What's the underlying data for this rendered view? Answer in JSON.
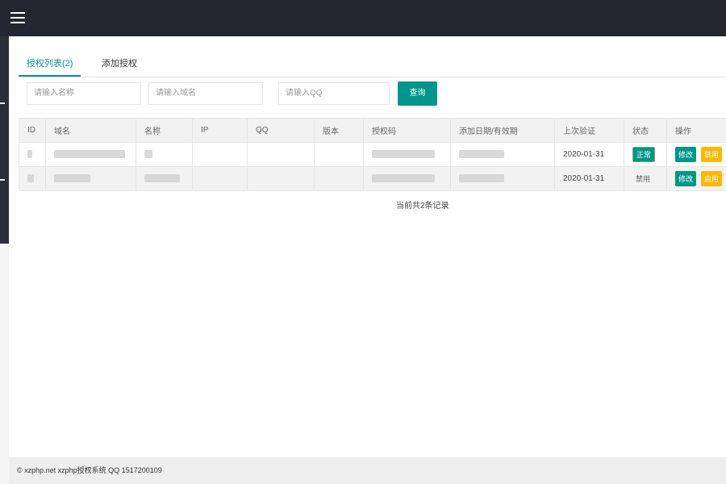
{
  "topbar": {
    "menu_icon": "hamburger-menu-icon"
  },
  "tabs": [
    {
      "label": "授权列表(2)",
      "active": true
    },
    {
      "label": "添加授权",
      "active": false
    }
  ],
  "search": {
    "name_placeholder": "请输入名称",
    "domain_placeholder": "请输入域名",
    "qq_placeholder": "请输入QQ",
    "button_label": "查询"
  },
  "table": {
    "headers": [
      "ID",
      "域名",
      "名称",
      "IP",
      "QQ",
      "版本",
      "授权码",
      "添加日期/有效期",
      "上次验证",
      "状态",
      "操作"
    ],
    "rows": [
      {
        "last_check": "2020-01-31",
        "status": "正常",
        "edit": "修改",
        "action": "禁用"
      },
      {
        "last_check": "2020-01-31",
        "status": "禁用",
        "edit": "修改",
        "action": "启用"
      }
    ]
  },
  "record_count": "当前共2条记录",
  "footer": "© xzphp.net xzphp授权系统 QQ 1517200109",
  "colors": {
    "accent": "#009688",
    "warning": "#ffb800",
    "topbar": "#23262e"
  }
}
